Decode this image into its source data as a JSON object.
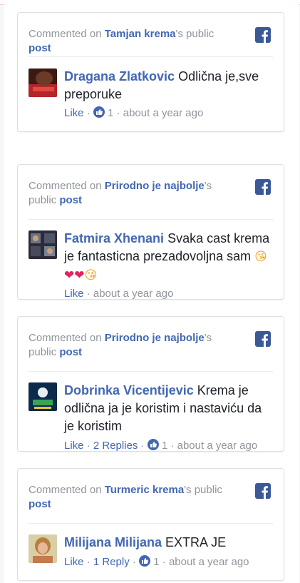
{
  "labels": {
    "commented_on": "Commented on",
    "possessive_public": "'s public",
    "post": "post",
    "like": "Like",
    "sep": " · "
  },
  "cards": [
    {
      "page": "Tamjan krema",
      "commenter": "Dragana Zlatkovic",
      "text": "Odlična je,sve preporuke",
      "likes": "1",
      "time": "about a year ago"
    },
    {
      "page": "Prirodno je najbolje",
      "commenter": "Fatmira Xhenani",
      "text": "Svaka cast krema je fantasticna prezadovoljna sam",
      "emojis": [
        "😘",
        "❤",
        "❤",
        "😘"
      ],
      "time": "about a year ago"
    },
    {
      "page": "Prirodno je najbolje",
      "commenter": "Dobrinka Vicentijevic",
      "text": "Krema je odlična ja je koristim i nastaviću da je koristim",
      "replies": "2 Replies",
      "likes": "1",
      "time": "about a year ago"
    },
    {
      "page": "Turmeric krema",
      "commenter": "Milijana Milijana",
      "text": "EXTRA JE",
      "replies": "1 Reply",
      "likes": "1",
      "time": "about a year ago"
    }
  ],
  "colors": {
    "link": "#4267b2",
    "muted": "#90949c",
    "facebook": "#3b5998"
  },
  "icons": [
    "facebook-icon",
    "like-thumb-icon",
    "kiss-emoji",
    "heart-emoji"
  ]
}
